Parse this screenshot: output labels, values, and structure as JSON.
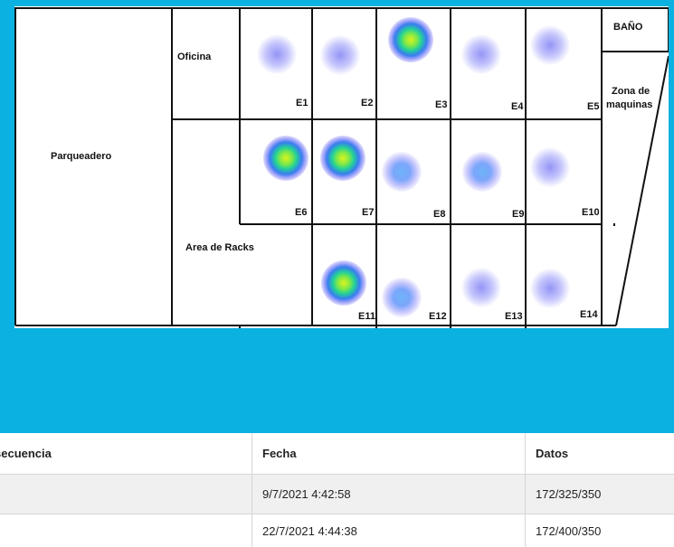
{
  "floor_plan": {
    "areas": {
      "parqueadero": "Parqueadero",
      "oficina": "Oficina",
      "area_racks": "Area de Racks",
      "bano": "BAÑO",
      "zona_maquinas_line1": "Zona de",
      "zona_maquinas_line2": "maquinas"
    },
    "zones": [
      {
        "label": "E1",
        "level": "low"
      },
      {
        "label": "E2",
        "level": "low"
      },
      {
        "label": "E3",
        "level": "high"
      },
      {
        "label": "E4",
        "level": "low"
      },
      {
        "label": "E5",
        "level": "low"
      },
      {
        "label": "E6",
        "level": "high"
      },
      {
        "label": "E7",
        "level": "high"
      },
      {
        "label": "E8",
        "level": "mid"
      },
      {
        "label": "E9",
        "level": "mid"
      },
      {
        "label": "E10",
        "level": "low"
      },
      {
        "label": "E11",
        "level": "high"
      },
      {
        "label": "E12",
        "level": "mid"
      },
      {
        "label": "E13",
        "level": "low"
      },
      {
        "label": "E14",
        "level": "low"
      }
    ],
    "colors": {
      "background": "#0bb1e0",
      "walls": "#111111",
      "heat_high_center": "#dcf31c",
      "heat_low": "#8c8cf5"
    }
  },
  "table": {
    "headers": [
      "secuencia",
      "Fecha",
      "Datos"
    ],
    "rows": [
      {
        "secuencia": "",
        "fecha": "9/7/2021 4:42:58",
        "datos": "172/325/350"
      },
      {
        "secuencia": "",
        "fecha": "22/7/2021 4:44:38",
        "datos": "172/400/350"
      }
    ]
  }
}
